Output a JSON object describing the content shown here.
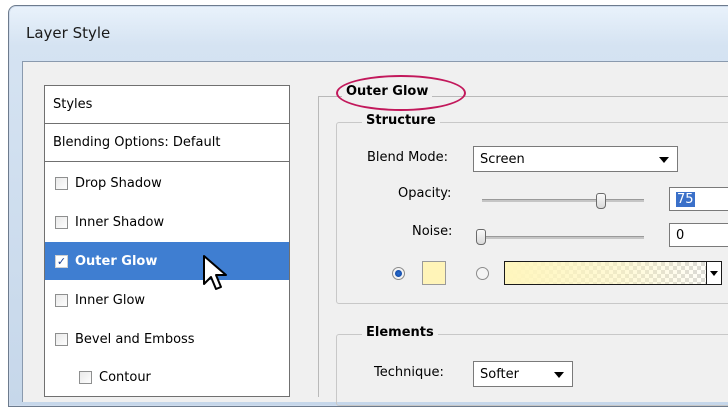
{
  "window": {
    "title": "Layer Style"
  },
  "styles_panel": {
    "header": "Styles",
    "blending_options": "Blending Options: Default",
    "items": [
      {
        "label": "Drop Shadow",
        "checked": false,
        "selected": false
      },
      {
        "label": "Inner Shadow",
        "checked": false,
        "selected": false
      },
      {
        "label": "Outer Glow",
        "checked": true,
        "selected": true
      },
      {
        "label": "Inner Glow",
        "checked": false,
        "selected": false
      },
      {
        "label": "Bevel and Emboss",
        "checked": false,
        "selected": false
      },
      {
        "label": "Contour",
        "checked": false,
        "selected": false
      }
    ],
    "check_glyph": "✓"
  },
  "outer_glow": {
    "title": "Outer Glow",
    "structure": {
      "title": "Structure",
      "blend_mode_label": "Blend Mode:",
      "blend_mode_value": "Screen",
      "opacity_label": "Opacity:",
      "opacity_value": "75",
      "opacity_level": 75,
      "noise_label": "Noise:",
      "noise_value": "0",
      "noise_level": 0,
      "color_mode": "solid",
      "glow_color": "#fff4b8"
    },
    "elements": {
      "title": "Elements",
      "technique_label": "Technique:",
      "technique_value": "Softer"
    }
  },
  "colors": {
    "highlight": "#3f7ed1",
    "annotation_oval": "#c2185b"
  }
}
